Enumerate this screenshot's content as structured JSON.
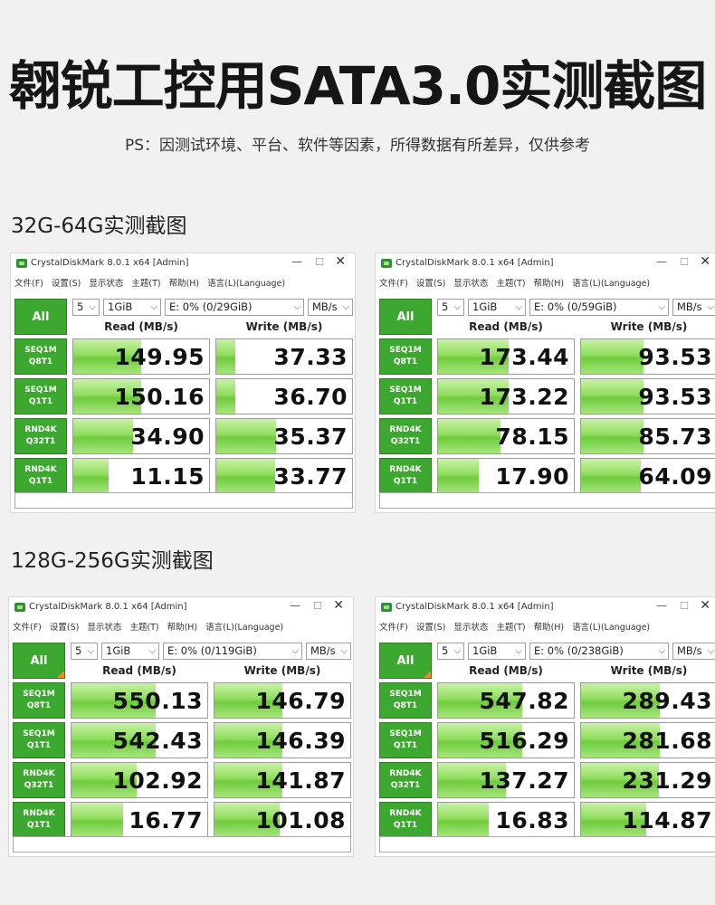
{
  "page": {
    "title": "翱锐工控用SATA3.0实测截图",
    "note": "PS：因测试环境、平台、软件等因素，所得数据有所差异，仅供参考"
  },
  "sections": [
    {
      "heading": "32G-64G实测截图"
    },
    {
      "heading": "128G-256G实测截图"
    }
  ],
  "colors": {
    "accent_green": "#3da82f",
    "bar_green": "#8fdd5e",
    "corner_orange": "#f08a24"
  },
  "windows": [
    {
      "title": "CrystalDiskMark 8.0.1 x64 [Admin]",
      "menu": [
        "文件(F)",
        "设置(S)",
        "显示状态",
        "主题(T)",
        "帮助(H)",
        "语言(L)(Language)"
      ],
      "all_label": "All",
      "count": "5",
      "size": "1GiB",
      "drive": "E: 0% (0/29GiB)",
      "unit": "MB/s",
      "read_header": "Read (MB/s)",
      "write_header": "Write (MB/s)",
      "rows": [
        {
          "l1": "SEQ1M",
          "l2": "Q8T1",
          "read": "149.95",
          "write": "37.33",
          "read_fill": 0.5,
          "write_fill": 0.14
        },
        {
          "l1": "SEQ1M",
          "l2": "Q1T1",
          "read": "150.16",
          "write": "36.70",
          "read_fill": 0.5,
          "write_fill": 0.14
        },
        {
          "l1": "RND4K",
          "l2": "Q32T1",
          "read": "34.90",
          "write": "35.37",
          "read_fill": 0.44,
          "write_fill": 0.44
        },
        {
          "l1": "RND4K",
          "l2": "Q1T1",
          "read": "11.15",
          "write": "33.77",
          "read_fill": 0.26,
          "write_fill": 0.43
        }
      ]
    },
    {
      "title": "CrystalDiskMark 8.0.1 x64 [Admin]",
      "menu": [
        "文件(F)",
        "设置(S)",
        "显示状态",
        "主题(T)",
        "帮助(H)",
        "语言(L)(Language)"
      ],
      "all_label": "All",
      "count": "5",
      "size": "1GiB",
      "drive": "E: 0% (0/59GiB)",
      "unit": "MB/s",
      "read_header": "Read (MB/s)",
      "write_header": "Write (MB/s)",
      "rows": [
        {
          "l1": "SEQ1M",
          "l2": "Q8T1",
          "read": "173.44",
          "write": "93.53",
          "read_fill": 0.52,
          "write_fill": 0.46
        },
        {
          "l1": "SEQ1M",
          "l2": "Q1T1",
          "read": "173.22",
          "write": "93.53",
          "read_fill": 0.52,
          "write_fill": 0.46
        },
        {
          "l1": "RND4K",
          "l2": "Q32T1",
          "read": "78.15",
          "write": "85.73",
          "read_fill": 0.46,
          "write_fill": 0.46
        },
        {
          "l1": "RND4K",
          "l2": "Q1T1",
          "read": "17.90",
          "write": "64.09",
          "read_fill": 0.3,
          "write_fill": 0.44
        }
      ]
    },
    {
      "title": "CrystalDiskMark 8.0.1 x64 [Admin]",
      "menu": [
        "文件(F)",
        "设置(S)",
        "显示状态",
        "主题(T)",
        "帮助(H)",
        "语言(L)(Language)"
      ],
      "all_label": "All",
      "count": "5",
      "size": "1GiB",
      "drive": "E: 0% (0/119GiB)",
      "unit": "MB/s",
      "read_header": "Read (MB/s)",
      "write_header": "Write (MB/s)",
      "rows": [
        {
          "l1": "SEQ1M",
          "l2": "Q8T1",
          "read": "550.13",
          "write": "146.79",
          "read_fill": 0.62,
          "write_fill": 0.5
        },
        {
          "l1": "SEQ1M",
          "l2": "Q1T1",
          "read": "542.43",
          "write": "146.39",
          "read_fill": 0.62,
          "write_fill": 0.5
        },
        {
          "l1": "RND4K",
          "l2": "Q32T1",
          "read": "102.92",
          "write": "141.87",
          "read_fill": 0.48,
          "write_fill": 0.5
        },
        {
          "l1": "RND4K",
          "l2": "Q1T1",
          "read": "16.77",
          "write": "101.08",
          "read_fill": 0.38,
          "write_fill": 0.48
        }
      ]
    },
    {
      "title": "CrystalDiskMark 8.0.1 x64 [Admin]",
      "menu": [
        "文件(F)",
        "设置(S)",
        "显示状态",
        "主题(T)",
        "帮助(H)",
        "语言(L)(Language)"
      ],
      "all_label": "All",
      "count": "5",
      "size": "1GiB",
      "drive": "E: 0% (0/238GiB)",
      "unit": "MB/s",
      "read_header": "Read (MB/s)",
      "write_header": "Write (MB/s)",
      "rows": [
        {
          "l1": "SEQ1M",
          "l2": "Q8T1",
          "read": "547.82",
          "write": "289.43",
          "read_fill": 0.62,
          "write_fill": 0.58
        },
        {
          "l1": "SEQ1M",
          "l2": "Q1T1",
          "read": "516.29",
          "write": "281.68",
          "read_fill": 0.62,
          "write_fill": 0.58
        },
        {
          "l1": "RND4K",
          "l2": "Q32T1",
          "read": "137.27",
          "write": "231.29",
          "read_fill": 0.5,
          "write_fill": 0.57
        },
        {
          "l1": "RND4K",
          "l2": "Q1T1",
          "read": "16.83",
          "write": "114.87",
          "read_fill": 0.37,
          "write_fill": 0.48
        }
      ]
    }
  ]
}
